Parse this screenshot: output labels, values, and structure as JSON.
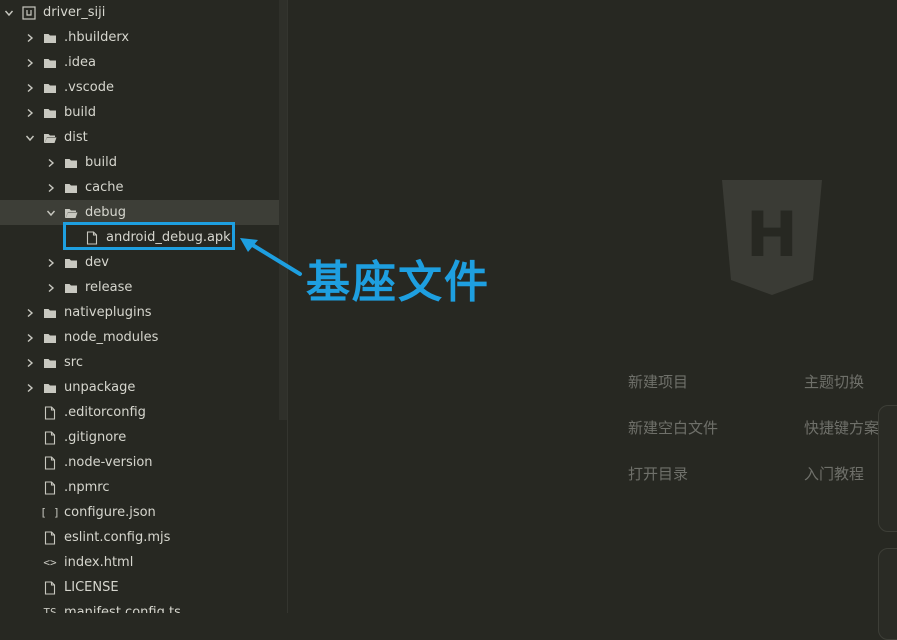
{
  "explorer": {
    "root": {
      "label": "driver_siji",
      "expanded": true
    },
    "items": [
      {
        "label": ".hbuilderx",
        "depth": 1,
        "type": "folder",
        "expanded": false
      },
      {
        "label": ".idea",
        "depth": 1,
        "type": "folder",
        "expanded": false
      },
      {
        "label": ".vscode",
        "depth": 1,
        "type": "folder",
        "expanded": false
      },
      {
        "label": "build",
        "depth": 1,
        "type": "folder",
        "expanded": false
      },
      {
        "label": "dist",
        "depth": 1,
        "type": "folder",
        "expanded": true
      },
      {
        "label": "build",
        "depth": 2,
        "type": "folder",
        "expanded": false
      },
      {
        "label": "cache",
        "depth": 2,
        "type": "folder",
        "expanded": false
      },
      {
        "label": "debug",
        "depth": 2,
        "type": "folder",
        "expanded": true,
        "selected": true
      },
      {
        "label": "android_debug.apk",
        "depth": 3,
        "type": "file"
      },
      {
        "label": "dev",
        "depth": 2,
        "type": "folder",
        "expanded": false
      },
      {
        "label": "release",
        "depth": 2,
        "type": "folder",
        "expanded": false
      },
      {
        "label": "nativeplugins",
        "depth": 1,
        "type": "folder",
        "expanded": false
      },
      {
        "label": "node_modules",
        "depth": 1,
        "type": "folder",
        "expanded": false
      },
      {
        "label": "src",
        "depth": 1,
        "type": "folder",
        "expanded": false
      },
      {
        "label": "unpackage",
        "depth": 1,
        "type": "folder",
        "expanded": false
      },
      {
        "label": ".editorconfig",
        "depth": 1,
        "type": "file"
      },
      {
        "label": ".gitignore",
        "depth": 1,
        "type": "file"
      },
      {
        "label": ".node-version",
        "depth": 1,
        "type": "file"
      },
      {
        "label": ".npmrc",
        "depth": 1,
        "type": "file"
      },
      {
        "label": "configure.json",
        "depth": 1,
        "type": "json",
        "glyph": "[ ]"
      },
      {
        "label": "eslint.config.mjs",
        "depth": 1,
        "type": "file"
      },
      {
        "label": "index.html",
        "depth": 1,
        "type": "html",
        "glyph": "<>"
      },
      {
        "label": "LICENSE",
        "depth": 1,
        "type": "file"
      },
      {
        "label": "manifest.config.ts",
        "depth": 1,
        "type": "ts",
        "glyph": "TS"
      }
    ]
  },
  "annotation": {
    "label": "基座文件",
    "color": "#1e9fe0"
  },
  "logo": {
    "letter": "H"
  },
  "welcome": {
    "left": [
      "新建项目",
      "新建空白文件",
      "打开目录"
    ],
    "right": [
      "主题切换",
      "快捷键方案",
      "入门教程"
    ]
  },
  "colors": {
    "background": "#272822",
    "selected_row": "#3d3e37",
    "accent": "#1e9fe0",
    "muted_text": "#6f706a"
  }
}
